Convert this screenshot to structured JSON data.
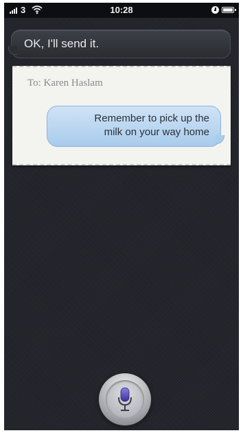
{
  "status_bar": {
    "carrier": "3",
    "time": "10:28",
    "icons": [
      "signal-bars-icon",
      "wifi-icon",
      "orientation-lock-icon",
      "battery-icon"
    ]
  },
  "siri": {
    "response": "OK, I'll send it."
  },
  "message": {
    "to": "To: Karen Haslam",
    "body_line1": "Remember to pick up the",
    "body_line2": "milk on your way home"
  },
  "mic": {
    "icon": "microphone-icon",
    "accent_color": "#4b3fa8"
  }
}
